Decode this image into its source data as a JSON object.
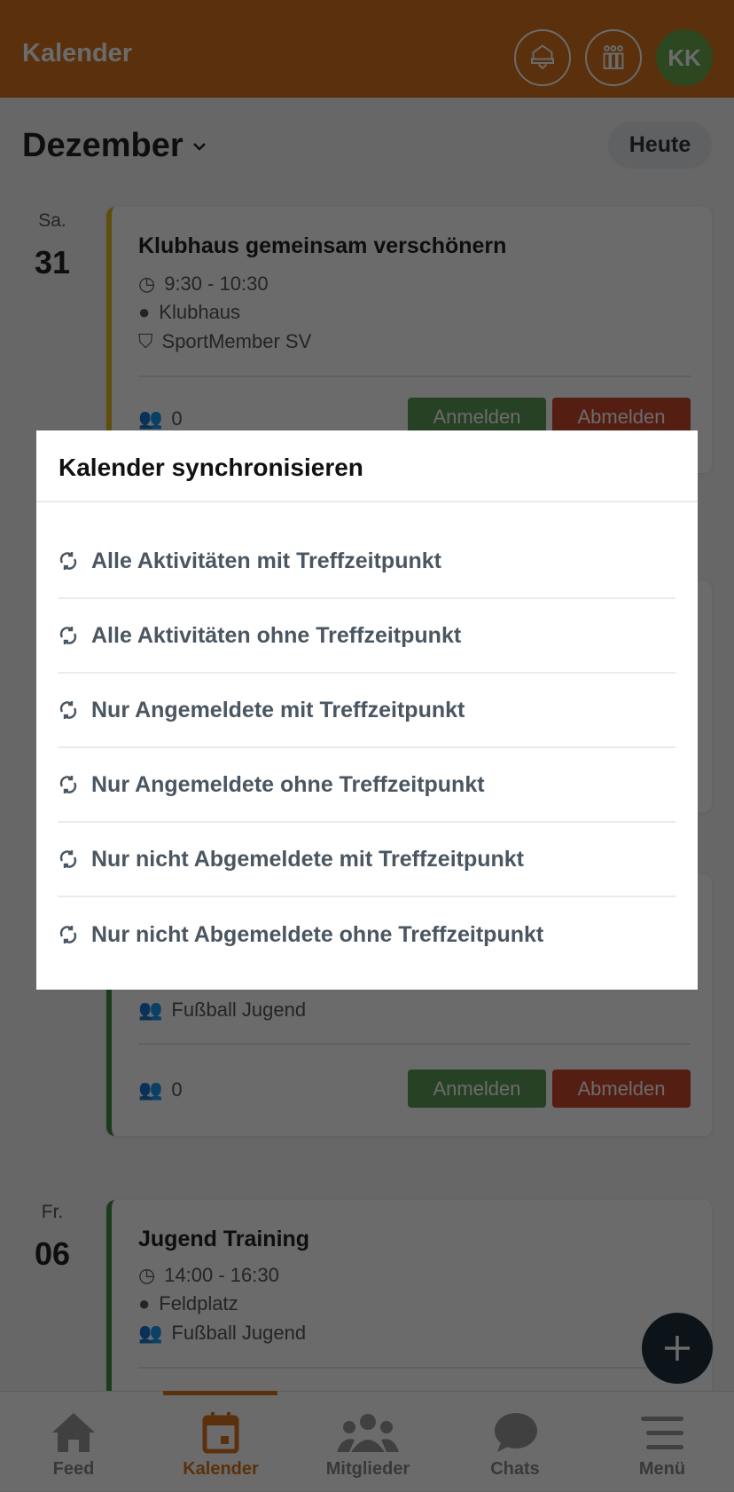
{
  "header": {
    "title": "Kalender",
    "avatar_initials": "KK",
    "icons": [
      "club-crest-icon",
      "teams-icon"
    ]
  },
  "month": {
    "label": "Dezember",
    "today_button": "Heute"
  },
  "events": [
    {
      "weekday": "Sa.",
      "day": "31",
      "title": "Klubhaus gemeinsam verschönern",
      "time": "9:30 - 10:30",
      "location": "Klubhaus",
      "group": "SportMember SV",
      "participants": "0",
      "accent": "#e3b81f",
      "join": "Anmelden",
      "leave": "Abmelden"
    },
    {
      "group": "Fußball Jugend",
      "participants": "0",
      "accent": "#3f8f46",
      "join": "Anmelden",
      "leave": "Abmelden"
    },
    {
      "weekday": "Fr.",
      "day": "06",
      "title": "Jugend Training",
      "time": "14:00 - 16:30",
      "location": "Feldplatz",
      "group": "Fußball Jugend",
      "accent": "#3f8f46"
    }
  ],
  "nav": {
    "items": [
      {
        "label": "Feed",
        "icon": "home-icon"
      },
      {
        "label": "Kalender",
        "icon": "calendar-icon",
        "active": true
      },
      {
        "label": "Mitglieder",
        "icon": "members-icon"
      },
      {
        "label": "Chats",
        "icon": "chat-icon"
      },
      {
        "label": "Menü",
        "icon": "menu-icon"
      }
    ]
  },
  "colors": {
    "primary": "#d8741f",
    "join": "#5e9a55",
    "leave": "#c9472e",
    "fab": "#1d2d3b"
  },
  "modal": {
    "title": "Kalender synchronisieren",
    "options": [
      "Alle Aktivitäten mit Treffzeitpunkt",
      "Alle Aktivitäten ohne Treffzeitpunkt",
      "Nur Angemeldete mit Treffzeitpunkt",
      "Nur Angemeldete ohne Treffzeitpunkt",
      "Nur nicht Abgemeldete mit Treffzeitpunkt",
      "Nur nicht Abgemeldete ohne Treffzeitpunkt"
    ]
  }
}
